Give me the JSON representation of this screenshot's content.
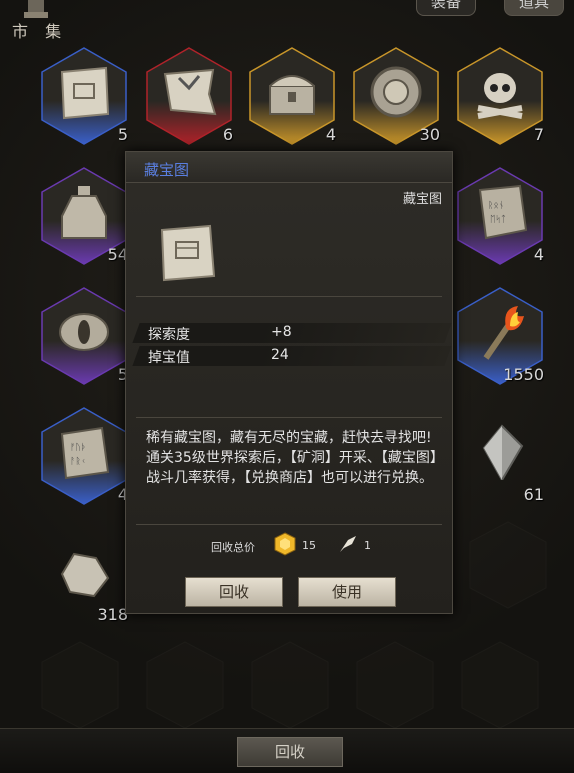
{
  "header": {
    "market_label": "市 集",
    "tabs": [
      {
        "label": "装备",
        "active": false
      },
      {
        "label": "道具",
        "active": true
      }
    ]
  },
  "inventory": [
    {
      "item": "treasure-map",
      "count": "5",
      "rarity": "blue"
    },
    {
      "item": "torn-red-map",
      "count": "6",
      "rarity": "red"
    },
    {
      "item": "treasure-chest",
      "count": "4",
      "rarity": "gold"
    },
    {
      "item": "stone-medallion",
      "count": "30",
      "rarity": "gold"
    },
    {
      "item": "skull-crossbones",
      "count": "7",
      "rarity": "gold"
    },
    {
      "item": "potion-bottle",
      "count": "54",
      "rarity": "purple"
    },
    {
      "item": "rune-stone",
      "count": "4",
      "rarity": "purple"
    },
    {
      "item": "eye-relic",
      "count": "5",
      "rarity": "purple"
    },
    {
      "item": "torch",
      "count": "1550",
      "rarity": "blue"
    },
    {
      "item": "rune-tablet",
      "count": "4",
      "rarity": "blue"
    },
    {
      "item": "crystal-shard",
      "count": "61",
      "rarity": "none"
    },
    {
      "item": "rock-fragment",
      "count": "318",
      "rarity": "none"
    }
  ],
  "popup": {
    "title": "藏宝图",
    "category": "藏宝图",
    "stats": [
      {
        "label": "探索度",
        "value": "+8"
      },
      {
        "label": "掉宝值",
        "value": "24"
      }
    ],
    "description": [
      "稀有藏宝图，藏有无尽的宝藏，赶快去寻找吧!",
      "通关35级世界探索后，【矿洞】开采、【藏宝图】战斗几率获得，【兑换商店】也可以进行兑换。"
    ],
    "recycle_total_label": "回收总价",
    "recycle_gold": "15",
    "recycle_feather": "1",
    "recycle_button": "回收",
    "use_button": "使用"
  },
  "bottom": {
    "recycle_button": "回收"
  },
  "colors": {
    "blue": "#3a5fc8",
    "red": "#b0232a",
    "gold": "#c9962a",
    "purple": "#6a3ab0",
    "title": "#5a7fe0"
  }
}
